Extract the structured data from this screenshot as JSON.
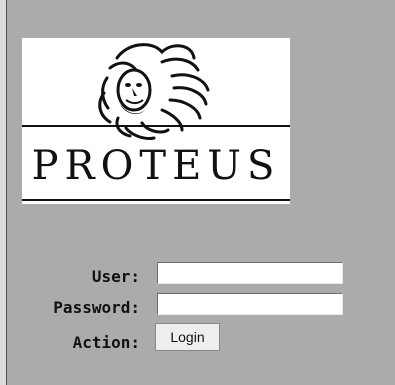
{
  "logo": {
    "text": "PROTEUS",
    "icon": "proteus-face-icon"
  },
  "form": {
    "user_label": "User:",
    "user_value": "",
    "password_label": "Password:",
    "password_value": "",
    "action_label": "Action:",
    "login_label": "Login"
  },
  "colors": {
    "background": "#ababab",
    "logo_background": "#ffffff"
  }
}
